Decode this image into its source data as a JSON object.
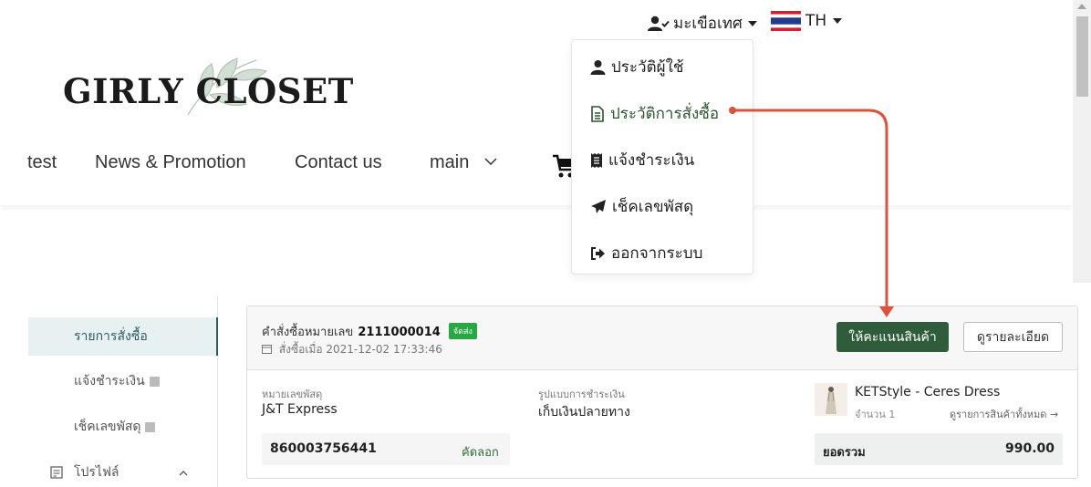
{
  "header": {
    "logo": "GIRLY CLOSET",
    "nav": [
      "test",
      "News & Promotion",
      "Contact us",
      "main"
    ],
    "user_name": "มะเขือเทศ",
    "language": "TH"
  },
  "dropdown": {
    "items": [
      "ประวัติผู้ใช้",
      "ประวัติการสั่งซื้อ",
      "แจ้งชำระเงิน",
      "เช็คเลขพัสดุ",
      "ออกจากระบบ"
    ]
  },
  "sidebar": {
    "items": [
      "รายการสั่งซื้อ",
      "แจ้งชำระเงิน",
      "เช็คเลขพัสดุ",
      "โปรไฟล์"
    ]
  },
  "order": {
    "number_label": "คำสั่งซื้อหมายเลข",
    "number": "2111000014",
    "status": "จัดส่ง",
    "date": "สั่งซื้อเมื่อ 2021-12-02 17:33:46",
    "rate_button": "ให้คะแนนสินค้า",
    "detail_button": "ดูรายละเอียด",
    "tracking_label": "หมายเลขพัสดุ",
    "carrier": "J&T Express",
    "payment_label": "รูปแบบการชำระเงิน",
    "payment_method": "เก็บเงินปลายทาง",
    "tracking_number": "860003756441",
    "copy_label": "คัดลอก",
    "product_name": "KETStyle - Ceres Dress",
    "quantity": "จำนวน 1",
    "view_all": "ดูรายการสินค้าทั้งหมด →",
    "total_label": "ยอดรวม",
    "total": "990.00"
  },
  "colors": {
    "accent_green": "#2f5c3a",
    "annotation_red": "#d9533f",
    "sidebar_active": "#2f5c63"
  }
}
